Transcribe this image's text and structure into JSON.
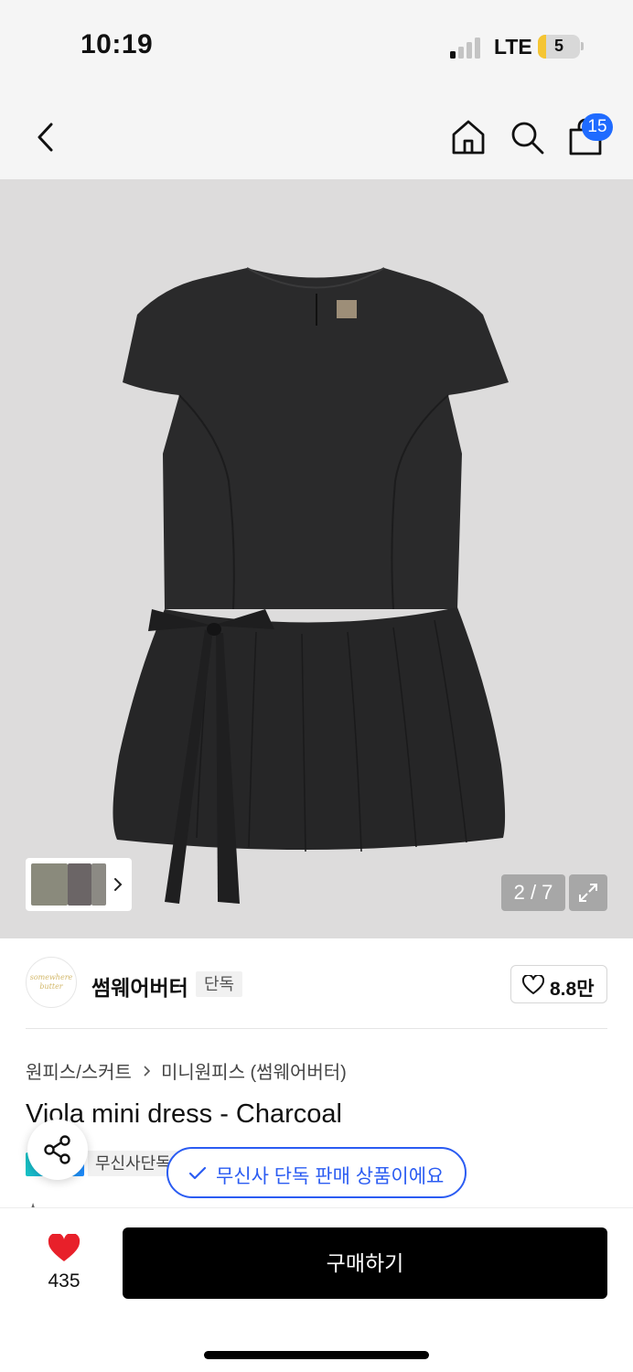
{
  "status_bar": {
    "time": "10:19",
    "network": "LTE",
    "battery_level": "5"
  },
  "nav": {
    "back_icon": "chevron-left-icon",
    "home_icon": "home-icon",
    "search_icon": "search-icon",
    "cart_icon": "shopping-bag-icon",
    "cart_count": "15"
  },
  "gallery": {
    "page_indicator": "2 / 7",
    "current_page": 2,
    "total_pages": 7,
    "expand_icon": "expand-icon"
  },
  "brand": {
    "logo_text": "somewhere butter",
    "name": "썸웨어버터",
    "tag": "단독",
    "like_count": "8.8만"
  },
  "breadcrumb": {
    "category": "원피스/스커트",
    "subcategory": "미니원피스 (썸웨어버터)"
  },
  "product": {
    "title": "Viola mini dress - Charcoal",
    "exclusive_badge": "무신사단독"
  },
  "toast": {
    "message": "무신사 단독 판매 상품이에요"
  },
  "bottom_bar": {
    "heart_count": "435",
    "buy_label": "구매하기"
  },
  "colors": {
    "accent_blue": "#2b5cf2",
    "cart_badge": "#1f6bff",
    "heart_red": "#e8202a",
    "buy_button": "#000000"
  }
}
